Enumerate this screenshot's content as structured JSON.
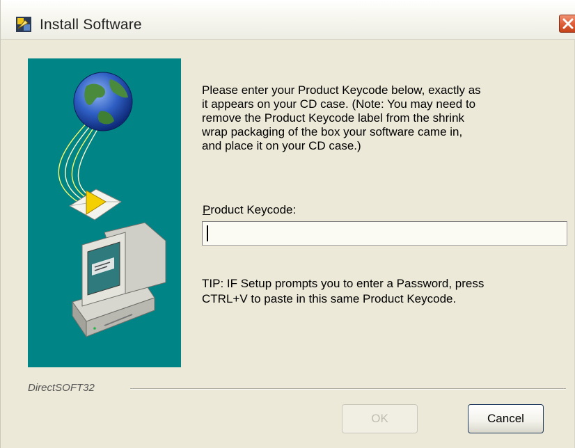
{
  "window": {
    "title": "Install Software",
    "icons": {
      "app": "install-software-icon",
      "close": "close-icon"
    }
  },
  "illustration": {
    "icons": [
      "globe-icon",
      "envelope-icon",
      "computer-icon"
    ]
  },
  "content": {
    "message_lines": [
      "Please enter your Product Keycode below, exactly as",
      "it appears on your CD case.  (Note:  You may need to",
      "remove the Product Keycode label from the shrink",
      "wrap packaging of the box your software came in,",
      "and place it on your CD case.)"
    ],
    "keycode_label_accel": "P",
    "keycode_label_rest": "roduct Keycode:",
    "keycode_value": "",
    "tip_lines": [
      "TIP:  IF Setup prompts you to enter a Password, press",
      "CTRL+V to paste in this same Product Keycode."
    ]
  },
  "footer": {
    "brand": "DirectSOFT32",
    "ok_label": "OK",
    "ok_enabled": false,
    "cancel_label": "Cancel"
  },
  "colors": {
    "panel": "#008486",
    "dialog": "#ece9d8",
    "close_button": "#e0603a"
  }
}
